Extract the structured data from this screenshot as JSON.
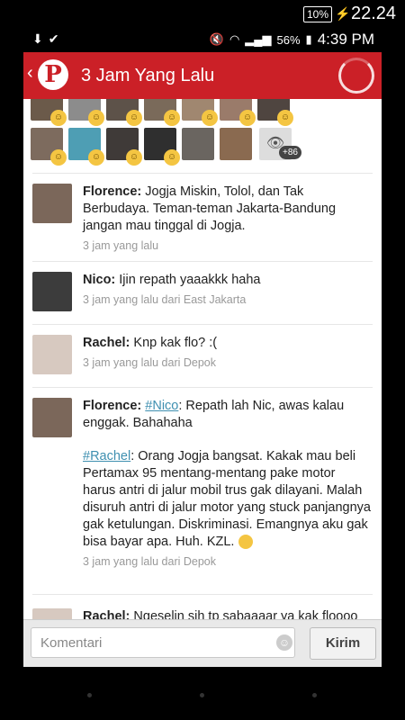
{
  "outer_status": {
    "battery": "10%",
    "time": "22.24"
  },
  "phone_status": {
    "battery": "56%",
    "time": "4:39 PM"
  },
  "header": {
    "title": "3 Jam Yang Lalu",
    "logo_letter": "P"
  },
  "likes": {
    "more_count": "+86"
  },
  "comments": [
    {
      "author": "Florence:",
      "text": "Jogja Miskin, Tolol, dan Tak Berbudaya. Teman-teman Jakarta-Bandung jangan mau tinggal di Jogja.",
      "meta": "3 jam yang lalu"
    },
    {
      "author": "Nico:",
      "text": "Ijin repath yaaakkk haha",
      "meta": "3 jam yang lalu dari East Jakarta"
    },
    {
      "author": "Rachel:",
      "text": "Knp kak flo? :(",
      "meta": "3 jam yang lalu dari Depok"
    },
    {
      "author": "Florence:",
      "mention1": "#Nico",
      "text": ": Repath lah Nic, awas kalau enggak. Bahahaha",
      "mention2": "#Rachel",
      "text2": ": Orang Jogja bangsat. Kakak mau beli Pertamax 95 mentang-mentang pake motor harus antri di jalur mobil trus gak dilayani. Malah disuruh antri di jalur motor yang stuck panjangnya gak ketulungan. Diskriminasi. Emangnya aku gak bisa bayar apa. Huh. KZL.",
      "meta": "3 jam yang lalu dari Depok"
    },
    {
      "author": "Rachel:",
      "text": "Ngeselin sih tp sabaaaar ya kak floooo"
    }
  ],
  "comment_bar": {
    "placeholder": "Komentari",
    "send_label": "Kirim"
  },
  "colors": {
    "brand_red": "#cb2027",
    "mention": "#3e8fb0"
  }
}
